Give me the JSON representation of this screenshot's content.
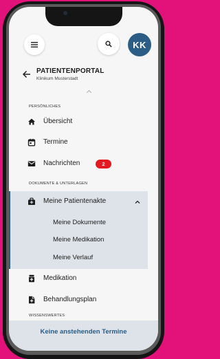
{
  "colors": {
    "background": "#e3117a",
    "accent": "#2b5d87",
    "badge": "#e21b23",
    "highlight": "#dde3e9"
  },
  "topbar": {
    "menu_icon": "hamburger-icon",
    "search_icon": "search-icon",
    "avatar_initials": "KK"
  },
  "header": {
    "back_icon": "arrow-left-icon",
    "title": "PATIENTENPORTAL",
    "subtitle": "Klinikum Musterstadt"
  },
  "sections": {
    "personal": "PERSÖNLICHES",
    "documents": "DOKUMENTE & UNTERLAGEN",
    "knowledge": "WISSENSWERTES"
  },
  "nav": {
    "overview": {
      "label": "Übersicht",
      "icon": "home-icon"
    },
    "appointments": {
      "label": "Termine",
      "icon": "calendar-icon"
    },
    "messages": {
      "label": "Nachrichten",
      "icon": "mail-icon",
      "badge": "2"
    },
    "records": {
      "label": "Meine Patientenakte",
      "icon": "medical-bag-icon",
      "expanded": true,
      "children": [
        "Meine Dokumente",
        "Meine Medikation",
        "Meine Verlauf"
      ]
    },
    "medication": {
      "label": "Medikation",
      "icon": "pill-bottle-icon"
    },
    "treatment": {
      "label": "Behandlungsplan",
      "icon": "document-icon"
    }
  },
  "footer": {
    "text": "Keine anstehenden Termine"
  }
}
